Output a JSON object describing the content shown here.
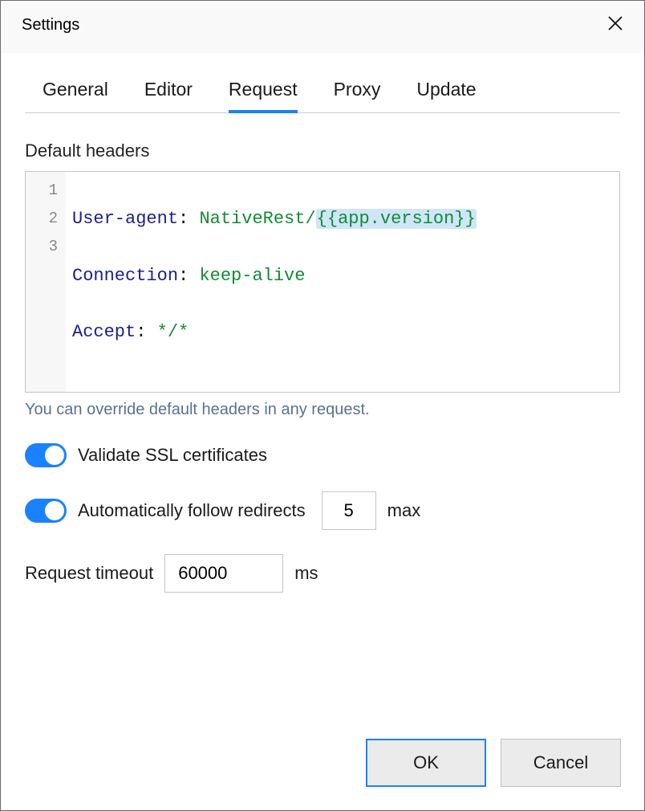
{
  "title": "Settings",
  "tabs": {
    "general": "General",
    "editor": "Editor",
    "request": "Request",
    "proxy": "Proxy",
    "update": "Update",
    "active": "request"
  },
  "headers_section": {
    "label": "Default headers",
    "lines": [
      {
        "num": "1",
        "key": "User-agent",
        "colon": ":",
        "val": "NativeRest/",
        "var": "{{app.version}}"
      },
      {
        "num": "2",
        "key": "Connection",
        "colon": ":",
        "val": "keep-alive"
      },
      {
        "num": "3",
        "key": "Accept",
        "colon": ":",
        "val": "*/*"
      }
    ],
    "hint": "You can override default headers in any request."
  },
  "options": {
    "validate_ssl": {
      "label": "Validate SSL certificates",
      "on": true
    },
    "follow_redirects": {
      "label": "Automatically follow redirects",
      "on": true,
      "max": "5",
      "suffix": "max"
    },
    "timeout": {
      "label": "Request timeout",
      "value": "60000",
      "suffix": "ms"
    }
  },
  "buttons": {
    "ok": "OK",
    "cancel": "Cancel"
  }
}
